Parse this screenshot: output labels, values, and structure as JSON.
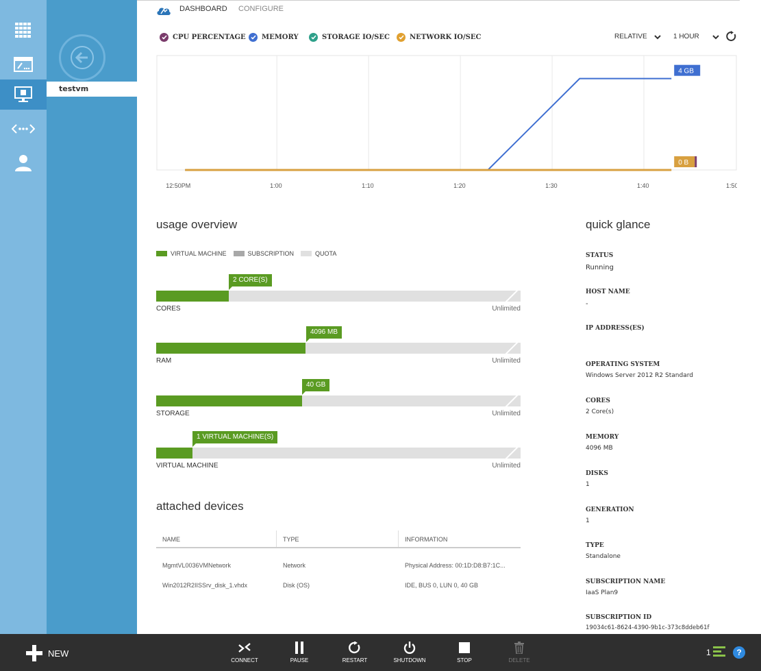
{
  "tabs": {
    "dashboard": "DASHBOARD",
    "configure": "CONFIGURE"
  },
  "panel": {
    "resource": "testvm"
  },
  "metrics": [
    {
      "label": "CPU PERCENTAGE",
      "color": "#7a3b6b"
    },
    {
      "label": "MEMORY",
      "color": "#3f6fd1"
    },
    {
      "label": "STORAGE IO/SEC",
      "color": "#2ea08a"
    },
    {
      "label": "NETWORK IO/SEC",
      "color": "#e0a030"
    }
  ],
  "controls": {
    "scale": "RELATIVE",
    "range": "1 HOUR"
  },
  "chart_data": {
    "type": "line",
    "x": [
      "12:50PM",
      "1:00",
      "1:10",
      "1:20",
      "1:23",
      "1:33",
      "1:43"
    ],
    "x_ticks": [
      "12:50PM",
      "1:00",
      "1:10",
      "1:20",
      "1:30",
      "1:40",
      "1:50"
    ],
    "series": [
      {
        "name": "MEMORY",
        "color": "#3f6fd1",
        "minutes": [
          0,
          33,
          43,
          53
        ],
        "values": [
          0,
          0,
          4,
          4
        ],
        "end_label": "4 GB"
      },
      {
        "name": "NETWORK IO/SEC",
        "color": "#d8a040",
        "minutes": [
          0,
          53
        ],
        "values": [
          0,
          0
        ],
        "end_label": "0 B"
      }
    ],
    "xrange_minutes": [
      -3,
      60
    ],
    "ylim": [
      0,
      4.5
    ],
    "grid": true
  },
  "usage": {
    "title": "usage overview",
    "legend": [
      {
        "label": "VIRTUAL MACHINE",
        "color": "#5a9b22"
      },
      {
        "label": "SUBSCRIPTION",
        "color": "#a8a8a8"
      },
      {
        "label": "QUOTA",
        "color": "#e0e0e0"
      }
    ],
    "rows": [
      {
        "name": "CORES",
        "tag": "2 CORE(S)",
        "limit": "Unlimited",
        "fraction": 0.2
      },
      {
        "name": "RAM",
        "tag": "4096 MB",
        "limit": "Unlimited",
        "fraction": 0.41
      },
      {
        "name": "STORAGE",
        "tag": "40 GB",
        "limit": "Unlimited",
        "fraction": 0.4
      },
      {
        "name": "VIRTUAL MACHINE",
        "tag": "1 VIRTUAL MACHINE(S)",
        "limit": "Unlimited",
        "fraction": 0.1
      }
    ]
  },
  "devices": {
    "title": "attached devices",
    "headers": [
      "NAME",
      "TYPE",
      "INFORMATION"
    ],
    "rows": [
      [
        "MgmtVL0036VMNetwork",
        "Network",
        "Physical Address: 00:1D:D8:B7:1C..."
      ],
      [
        "Win2012R2IISSrv_disk_1.vhdx",
        "Disk (OS)",
        "IDE, BUS 0, LUN 0, 40 GB"
      ]
    ]
  },
  "quick_glance": {
    "title": "quick glance",
    "items": [
      {
        "label": "STATUS",
        "value": "Running"
      },
      {
        "label": "HOST NAME",
        "value": "-"
      },
      {
        "label": "IP ADDRESS(ES)",
        "value": ""
      },
      {
        "label": "OPERATING SYSTEM",
        "value": "Windows Server 2012 R2 Standard"
      },
      {
        "label": "CORES",
        "value": "2 Core(s)"
      },
      {
        "label": "MEMORY",
        "value": "4096 MB"
      },
      {
        "label": "DISKS",
        "value": "1"
      },
      {
        "label": "GENERATION",
        "value": "1"
      },
      {
        "label": "TYPE",
        "value": "Standalone"
      },
      {
        "label": "SUBSCRIPTION NAME",
        "value": "IaaS Plan9"
      },
      {
        "label": "SUBSCRIPTION ID",
        "value": "19034c61-8624-4390-9b1c-373c8ddeb61f"
      }
    ]
  },
  "commands": {
    "new": "NEW",
    "items": [
      {
        "label": "CONNECT",
        "icon": "connect-icon"
      },
      {
        "label": "PAUSE",
        "icon": "pause-icon"
      },
      {
        "label": "RESTART",
        "icon": "restart-icon"
      },
      {
        "label": "SHUTDOWN",
        "icon": "power-icon"
      },
      {
        "label": "STOP",
        "icon": "stop-icon"
      },
      {
        "label": "DELETE",
        "icon": "trash-icon",
        "disabled": true
      }
    ],
    "notification_count": "1"
  },
  "icons": {
    "rail": [
      "grid-icon",
      "website-icon",
      "virtual-machine-icon",
      "network-icon",
      "user-icon"
    ],
    "back": "back-arrow-icon",
    "help": "?"
  }
}
